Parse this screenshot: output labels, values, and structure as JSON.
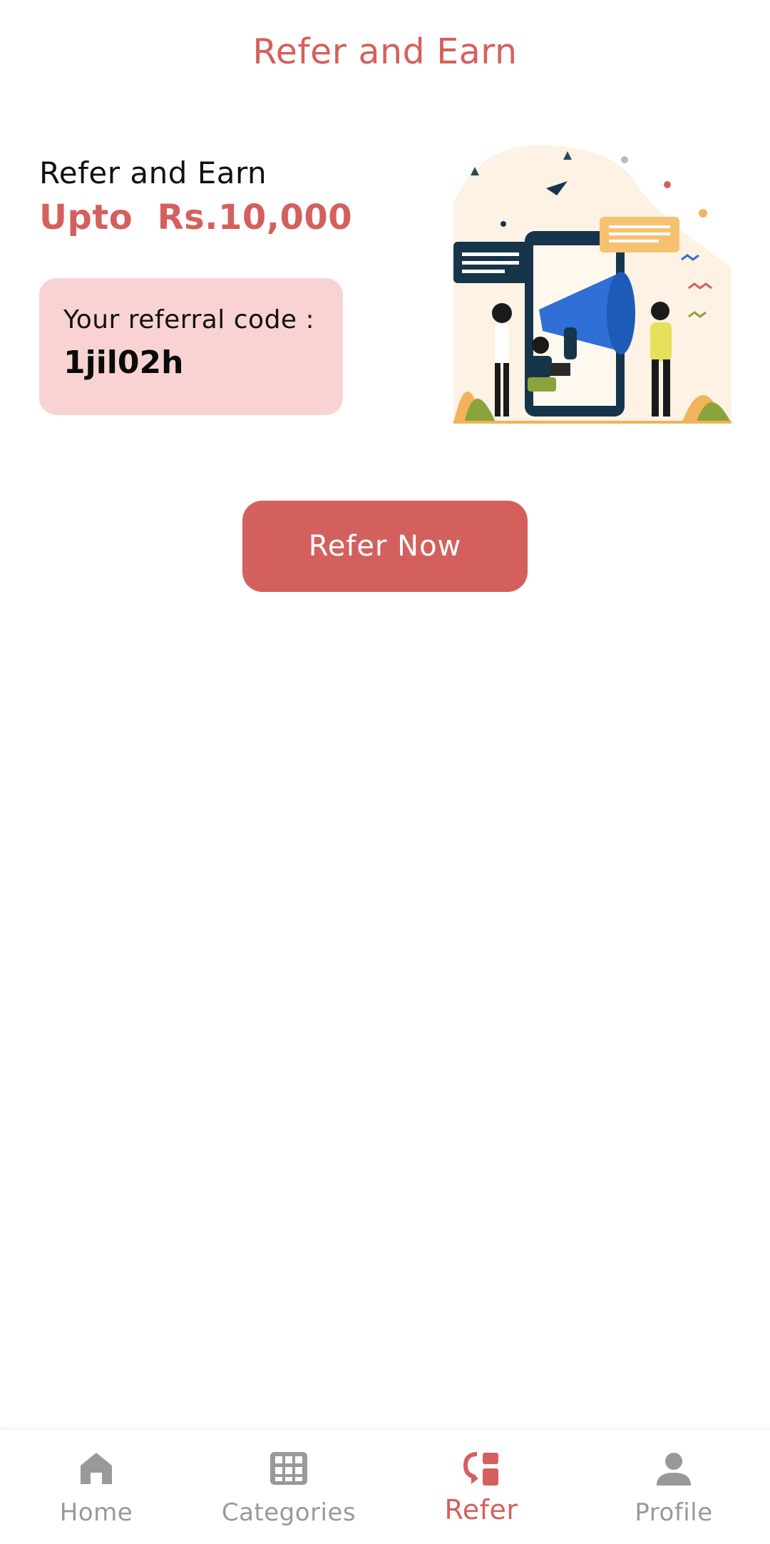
{
  "header": {
    "title": "Refer and Earn"
  },
  "hero": {
    "subtitle": "Refer and Earn",
    "amount": "Upto  Rs.10,000",
    "illustration_icon": "megaphone-illustration"
  },
  "referral": {
    "label": "Your referral code :",
    "code": "1jil02h"
  },
  "actions": {
    "refer_now": "Refer Now"
  },
  "bottom_nav": {
    "items": [
      {
        "label": "Home",
        "icon": "home-icon",
        "active": false
      },
      {
        "label": "Categories",
        "icon": "grid-icon",
        "active": false
      },
      {
        "label": "Refer",
        "icon": "refer-icon",
        "active": true
      },
      {
        "label": "Profile",
        "icon": "person-icon",
        "active": false
      }
    ]
  },
  "colors": {
    "accent": "#d4605d",
    "card_background": "#f9d3d3",
    "inactive": "#999999"
  }
}
